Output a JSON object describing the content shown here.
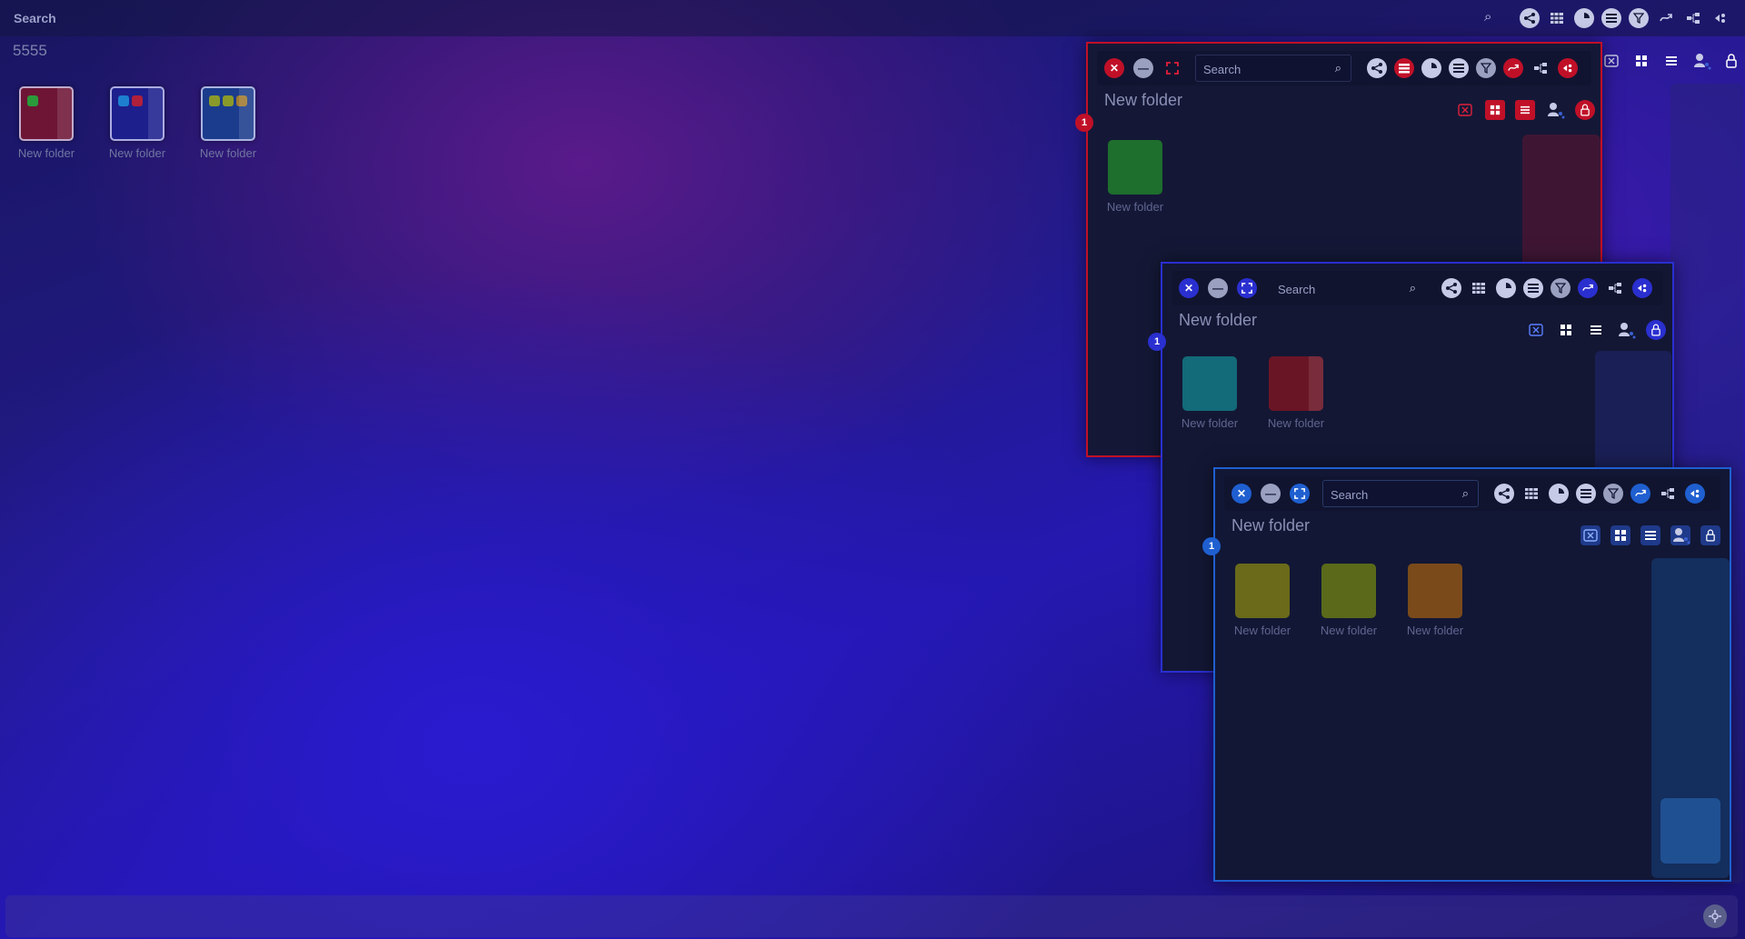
{
  "topbar": {
    "search_placeholder": "Search",
    "search_icon": "⌕",
    "icons": [
      "share-icon",
      "grid-list-icon",
      "pie-chart-icon",
      "list-icon",
      "filter-icon",
      "ribbon-icon",
      "sitemap-icon",
      "arrow-share-icon"
    ]
  },
  "desktop": {
    "title": "5555",
    "folders": [
      {
        "label": "New folder",
        "color": "#6e1535",
        "dots": [
          "#2a9a3a"
        ]
      },
      {
        "label": "New folder",
        "color": "#1c1f8c",
        "dots": [
          "#1e7fd0",
          "#b0203a"
        ]
      },
      {
        "label": "New folder",
        "color": "#1b3c8c",
        "dots": [
          "#8a9a2a",
          "#8a9a2a",
          "#a07a30"
        ]
      }
    ],
    "side_icons": [
      "close-box-icon",
      "grid-icon",
      "menu-icon",
      "user-network-icon",
      "lock-icon"
    ]
  },
  "window_red": {
    "title": "New folder",
    "search_placeholder": "Search",
    "badge": "1",
    "accent": "#c01028",
    "folders": [
      {
        "label": "New folder",
        "color": "#1e6e2e"
      }
    ]
  },
  "window_navy": {
    "title": "New folder",
    "search_placeholder": "Search",
    "badge": "1",
    "accent": "#2a2fd0",
    "folders": [
      {
        "label": "New folder",
        "color": "#136a78"
      },
      {
        "label": "New folder",
        "color": "#6a1525"
      }
    ]
  },
  "window_blue": {
    "title": "New folder",
    "search_placeholder": "Search",
    "badge": "1",
    "accent": "#1f5fd0",
    "folders": [
      {
        "label": "New folder",
        "color": "#6a6a1a"
      },
      {
        "label": "New folder",
        "color": "#5a6a1a"
      },
      {
        "label": "New folder",
        "color": "#7a4a1a"
      }
    ]
  },
  "bottombar": {
    "icon": "settings-network-icon"
  }
}
